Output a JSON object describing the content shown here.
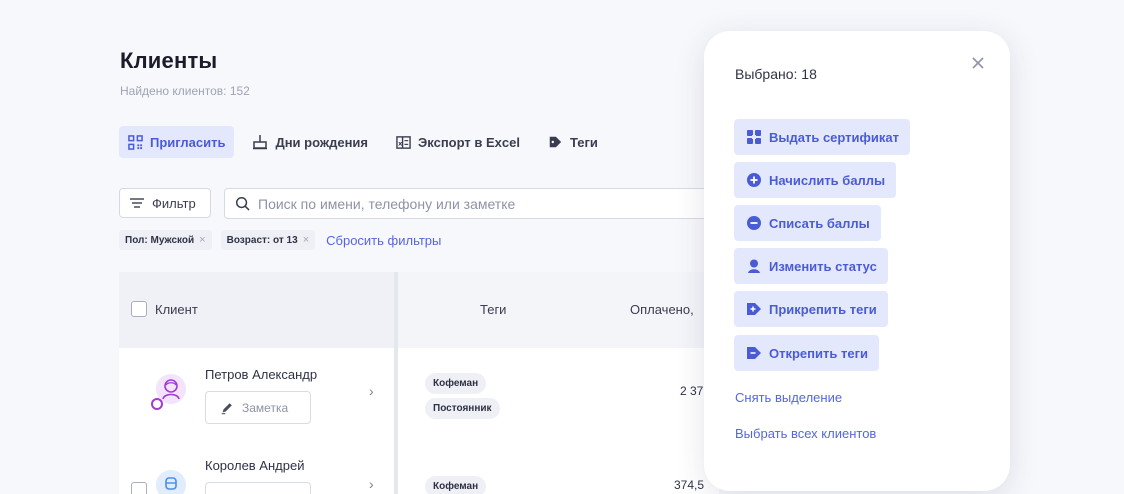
{
  "header": {
    "title": "Клиенты",
    "subtitle": "Найдено клиентов: 152"
  },
  "toolbar": {
    "invite": "Пригласить",
    "birthdays": "Дни рождения",
    "export": "Экспорт в Excel",
    "tags": "Теги"
  },
  "filter": {
    "button_label": "Фильтр",
    "search_placeholder": "Поиск по имени, телефону или заметке",
    "chips": [
      "Пол: Мужской",
      "Возраст: от 13"
    ],
    "chip_remove": "×",
    "reset": "Сбросить фильтры"
  },
  "table": {
    "headers": {
      "client": "Клиент",
      "tags": "Теги",
      "paid": "Оплачено,"
    },
    "rows": [
      {
        "name": "Петров Александр",
        "note": "Заметка",
        "tags": [
          "Кофеман",
          "Постоянник"
        ],
        "paid": "2 37"
      },
      {
        "name": "Королев Андрей",
        "note": "",
        "tags": [
          "Кофеман"
        ],
        "paid": "374,5"
      }
    ],
    "chevron": "›"
  },
  "selection_panel": {
    "selected": "Выбрано: 18",
    "actions": [
      {
        "label": "Выдать сертификат",
        "icon": "certificate-icon"
      },
      {
        "label": "Начислить баллы",
        "icon": "plus-circle-icon"
      },
      {
        "label": "Списать баллы",
        "icon": "minus-circle-icon"
      },
      {
        "label": "Изменить статус",
        "icon": "user-status-icon"
      },
      {
        "label": "Прикрепить теги",
        "icon": "tag-plus-icon"
      },
      {
        "label": "Открепить теги",
        "icon": "tag-minus-icon"
      }
    ],
    "clear_selection": "Снять выделение",
    "select_all": "Выбрать всех клиентов"
  },
  "colors": {
    "accent": "#4a5bd6",
    "accent_bg": "#e4e8fd",
    "link": "#5566dd",
    "avatar_purple": "#a23bd6",
    "avatar_blue": "#4a8ee6"
  }
}
